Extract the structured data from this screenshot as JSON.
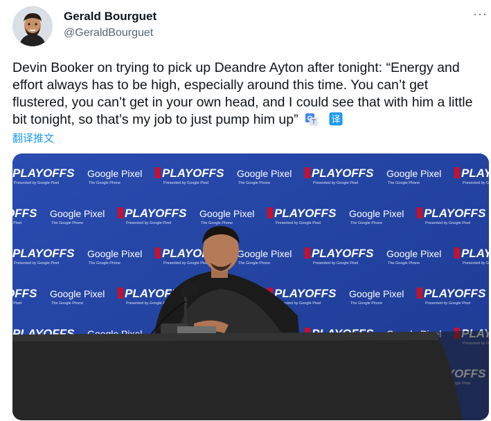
{
  "author": {
    "display_name": "Gerald Bourguet",
    "handle": "@GeraldBourguet",
    "avatar_icon": "avatar-illustration"
  },
  "menu": {
    "more_label": "···",
    "more_icon": "more-icon"
  },
  "tweet": {
    "text": "Devin Booker on trying to pick up Deandre Ayton after tonight: “Energy and effort always has to be high, especially around this time. You can’t get flustered, you can’t get in your own head, and I could see that with him a little bit tonight, so that’s my job to just pump him up”",
    "translate_link": "翻译推文",
    "translate_icon_google": "google-translate-icon",
    "translate_icon_2": "translate-icon",
    "translate_icon_glyph": "译"
  },
  "media": {
    "backdrop_logos": {
      "playoffs": "PLAYOFFS",
      "playoffs_sub": "Presented by Google Pixel",
      "google_pixel": "Google Pixel",
      "google_pixel_sub": "The Google Phone"
    },
    "colors": {
      "backdrop": "#2343a3",
      "table": "#262626",
      "accent_red": "#c8102e"
    }
  }
}
